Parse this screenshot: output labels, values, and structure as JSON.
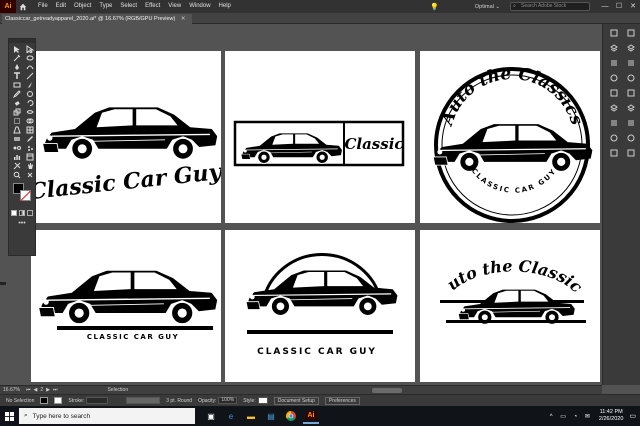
{
  "app": {
    "logo_text": "Ai",
    "menu": [
      "File",
      "Edit",
      "Object",
      "Type",
      "Select",
      "Effect",
      "View",
      "Window",
      "Help"
    ],
    "workspace": "Optimal ⌄",
    "search_placeholder": "Search Adobe Stock",
    "window_controls": [
      "—",
      "☐",
      "✕"
    ]
  },
  "document": {
    "tab_title": "Classiccar_getreadyapparel_2020.ai* @ 16.67% (RGB/GPU Preview)",
    "tab_close": "✕"
  },
  "artboards": [
    {
      "id": 1,
      "logo": "script",
      "script_text": "Classic Car Guy"
    },
    {
      "id": 2,
      "logo": "boxed",
      "script_text": "Classic"
    },
    {
      "id": 3,
      "logo": "badge",
      "script_text": "Auto the Classics",
      "sub_text": "CLASSIC CAR GUY"
    },
    {
      "id": 4,
      "logo": "bar",
      "sub_text": "CLASSIC CAR GUY"
    },
    {
      "id": 5,
      "logo": "arc",
      "sub_text": "CLASSIC CAR GUY"
    },
    {
      "id": 6,
      "logo": "arched-script",
      "script_text": "Auto the Classics"
    }
  ],
  "status": {
    "zoom": "16.67%",
    "artboard_number": "2",
    "selection": "Selection"
  },
  "control": {
    "selection_label": "No Selection",
    "stroke_label": "Stroke:",
    "brush_label": "3 pt. Round",
    "opacity_label": "Opacity:",
    "opacity_value": "100%",
    "style_label": "Style:",
    "doc_setup": "Document Setup",
    "preferences": "Preferences"
  },
  "taskbar": {
    "search_text": "Type here to search",
    "apps": [
      "task-view",
      "edge",
      "file-explorer",
      "store",
      "chrome",
      "illustrator"
    ],
    "tray": "^ ▭ ◔ ✉",
    "time": "11:42 PM",
    "date": "2/26/2020"
  },
  "colors": {
    "chrome_dark": "#323232",
    "canvas": "#535353",
    "artboard": "#ffffff",
    "ink": "#000000",
    "ai_logo": "#ff9a00"
  }
}
